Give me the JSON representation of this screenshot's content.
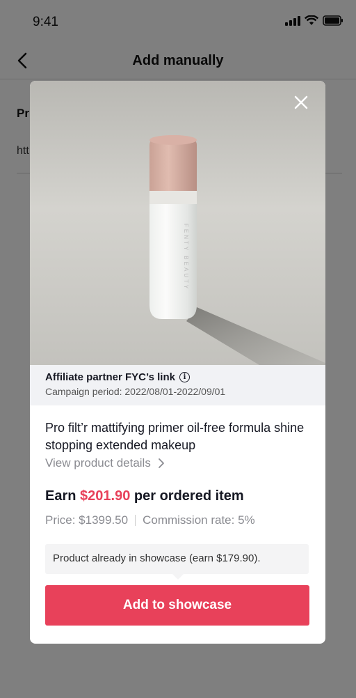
{
  "status_bar": {
    "time": "9:41"
  },
  "nav": {
    "title": "Add manually"
  },
  "form": {
    "label_partial": "Pr",
    "value_partial": "htt"
  },
  "modal": {
    "affiliate_title": "Affiliate partner FYC’s link",
    "campaign_period": "Campaign period: 2022/08/01-2022/09/01",
    "product_title": "Pro filt’r mattifying primer oil-free formula shine stopping extended makeup",
    "view_details": "View product details",
    "earn_prefix": "Earn",
    "earn_amount": "$201.90",
    "earn_suffix": "per ordered item",
    "price": "Price: $1399.50",
    "commission": "Commission rate: 5%",
    "notice": "Product already in showcase (earn $179.90).",
    "add_button": "Add to showcase",
    "bottle_text": "FENTY BEAUTY"
  },
  "colors": {
    "accent": "#e8415a",
    "overlay": "rgba(0,0,0,0.5)"
  },
  "icons": [
    "back-chevron-icon",
    "close-icon",
    "info-icon",
    "chevron-right-icon",
    "signal-icon",
    "wifi-icon",
    "battery-icon"
  ]
}
